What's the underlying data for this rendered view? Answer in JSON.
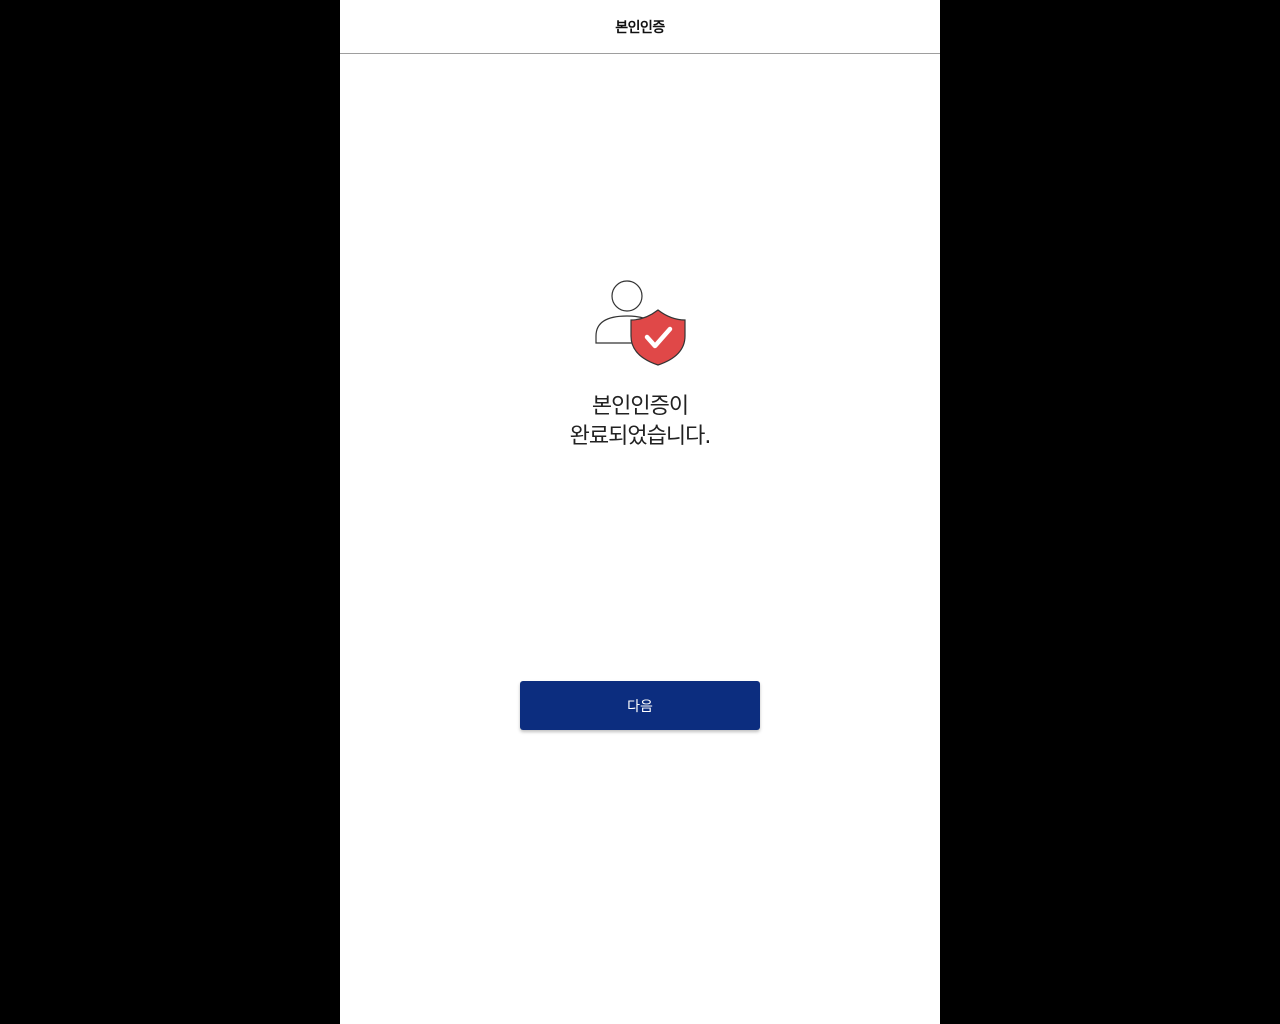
{
  "header": {
    "title": "본인인증"
  },
  "illustration": {
    "icon": "user-verified-shield-icon",
    "shield_color": "#e04848"
  },
  "message": {
    "line1": "본인인증이",
    "line2": "완료되었습니다."
  },
  "actions": {
    "next_label": "다음",
    "button_color": "#0c2d7f"
  }
}
